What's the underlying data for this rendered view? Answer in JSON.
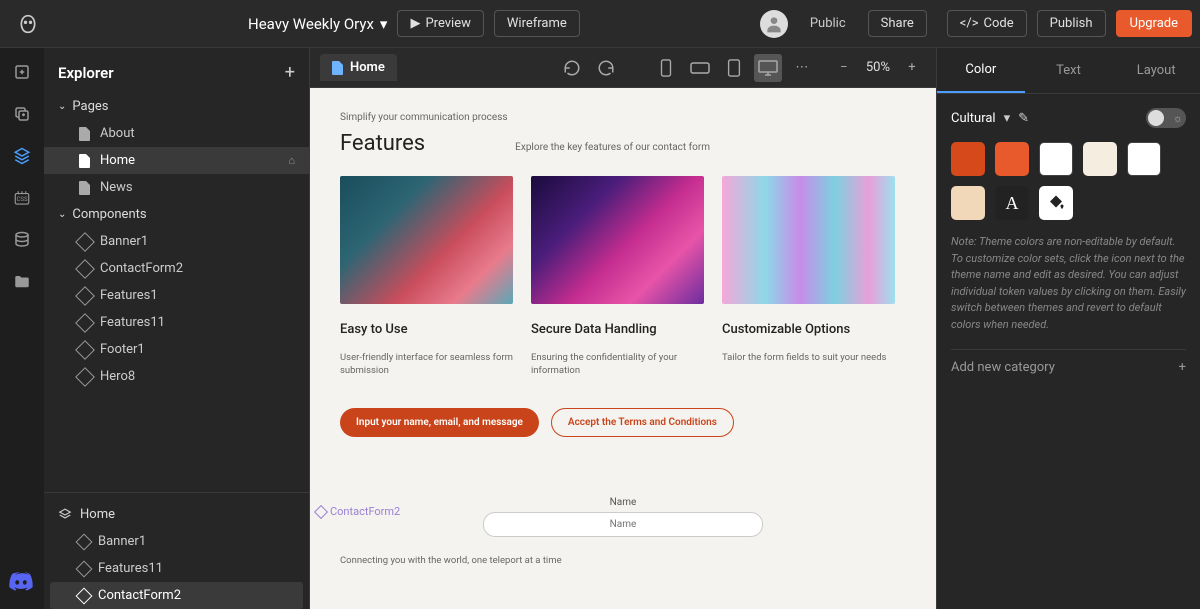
{
  "topbar": {
    "project_name": "Heavy Weekly Oryx",
    "preview": "Preview",
    "wireframe": "Wireframe",
    "public": "Public",
    "share": "Share",
    "code": "Code",
    "publish": "Publish",
    "upgrade": "Upgrade"
  },
  "explorer": {
    "title": "Explorer",
    "sections": {
      "pages": "Pages",
      "components": "Components"
    },
    "pages": [
      "About",
      "Home",
      "News"
    ],
    "components": [
      "Banner1",
      "ContactForm2",
      "Features1",
      "Features11",
      "Footer1",
      "Hero8"
    ],
    "outline_root": "Home",
    "outline": [
      "Banner1",
      "Features11",
      "ContactForm2"
    ]
  },
  "canvas": {
    "tab": "Home",
    "zoom": "50%",
    "eyebrow": "Simplify your communication process",
    "title": "Features",
    "subtitle": "Explore the key features of our contact form",
    "cards": [
      {
        "title": "Easy to Use",
        "desc": "User-friendly interface for seamless form submission"
      },
      {
        "title": "Secure Data Handling",
        "desc": "Ensuring the confidentiality of your information"
      },
      {
        "title": "Customizable Options",
        "desc": "Tailor the form fields to suit your needs"
      }
    ],
    "cta1": "Input your name, email, and message",
    "cta2": "Accept the Terms and Conditions",
    "section_marker": "ContactForm2",
    "form_label": "Name",
    "form_placeholder": "Name",
    "form_tagline": "Connecting you with the world, one teleport at a time"
  },
  "right": {
    "tabs": {
      "color": "Color",
      "text": "Text",
      "layout": "Layout"
    },
    "theme": "Cultural",
    "colors": [
      "#d6491a",
      "#e85a2c",
      "#ffffff",
      "#f5ede0",
      "#ffffff",
      "#f0d8b8"
    ],
    "note": "Note: Theme colors are non-editable by default. To customize color sets, click the icon next to the theme name and edit as desired. You can adjust individual token values by clicking on them. Easily switch between themes and revert to default colors when needed.",
    "add_category": "Add new category"
  }
}
